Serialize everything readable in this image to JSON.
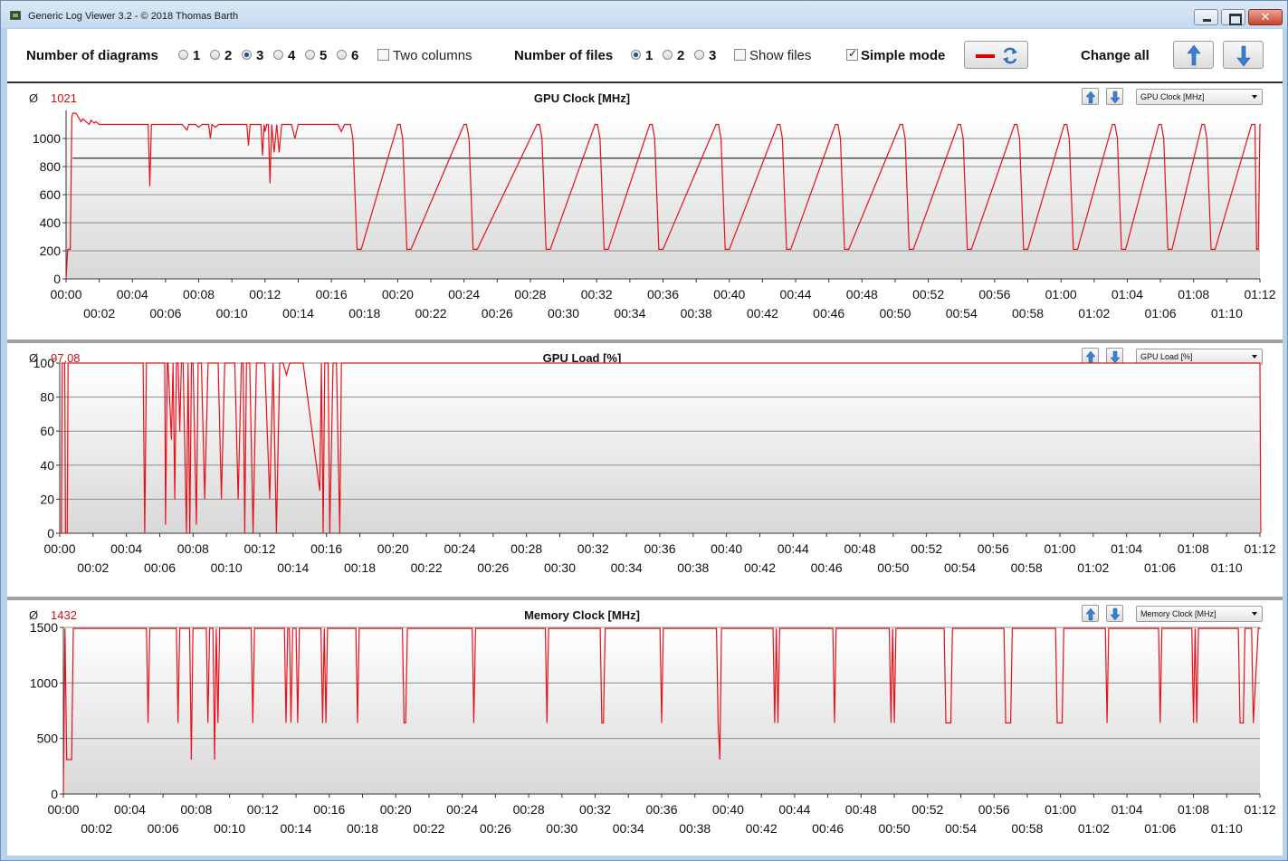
{
  "window": {
    "title": "Generic Log Viewer 3.2 - © 2018 Thomas Barth",
    "close_glyph": "✕"
  },
  "toolbar": {
    "num_diagrams_label": "Number of diagrams",
    "diagram_options": [
      "1",
      "2",
      "3",
      "4",
      "5",
      "6"
    ],
    "diagram_selected": "3",
    "two_columns_label": "Two columns",
    "two_columns_checked": false,
    "num_files_label": "Number of files",
    "file_options": [
      "1",
      "2",
      "3"
    ],
    "file_selected": "1",
    "show_files_label": "Show files",
    "show_files_checked": false,
    "simple_mode_label": "Simple mode",
    "simple_mode_checked": true,
    "change_all_label": "Change all",
    "icons": [
      "line-color-icon",
      "refresh-icon",
      "arrow-up-icon",
      "arrow-down-icon"
    ]
  },
  "colors": {
    "series": "#e8101a",
    "avg_line": "#000000",
    "grid": "#8c8c8c"
  },
  "chart_data": [
    {
      "type": "line",
      "title": "GPU Clock [MHz]",
      "avg_symbol": "Ø",
      "avg_value": "1021",
      "selector": "GPU Clock [MHz]",
      "ylim": [
        0,
        1200
      ],
      "yticks": [
        0,
        200,
        400,
        600,
        800,
        1000
      ],
      "xlim": [
        "00:00",
        "01:12"
      ],
      "xticks_row1": [
        "00:00",
        "00:04",
        "00:08",
        "00:12",
        "00:16",
        "00:20",
        "00:24",
        "00:28",
        "00:32",
        "00:36",
        "00:40",
        "00:44",
        "00:48",
        "00:52",
        "00:56",
        "01:00",
        "01:04",
        "01:08",
        "01:12"
      ],
      "xticks_row2": [
        "00:02",
        "00:06",
        "00:10",
        "00:14",
        "00:18",
        "00:22",
        "00:26",
        "00:30",
        "00:34",
        "00:38",
        "00:42",
        "00:46",
        "00:50",
        "00:54",
        "00:58",
        "01:02",
        "01:06",
        "01:10"
      ],
      "average_line": 860,
      "x_minutes": [
        0,
        0.1,
        0.25,
        0.35,
        0.4,
        0.5,
        0.6,
        0.9,
        1.0,
        1.2,
        1.3,
        1.4,
        1.5,
        1.6,
        1.7,
        1.8,
        1.9,
        2.0,
        2.2,
        2.4,
        2.6,
        2.8,
        3.0,
        3.5,
        4.0,
        4.5,
        4.95,
        5.05,
        5.15,
        5.5,
        6.0,
        6.5,
        7.0,
        7.3,
        7.4,
        7.5,
        7.8,
        8.0,
        8.2,
        8.6,
        8.7,
        8.8,
        9.0,
        9.2,
        9.5,
        10.0,
        10.5,
        10.9,
        11.0,
        11.1,
        11.5,
        11.75,
        11.85,
        11.95,
        12.0,
        12.1,
        12.2,
        12.3,
        12.4,
        12.55,
        12.7,
        12.85,
        13.0,
        13.3,
        13.6,
        13.8,
        14.0,
        14.3,
        14.8,
        15.2,
        15.6,
        16.0,
        16.2,
        16.4,
        16.6,
        16.8,
        17.0,
        17.15,
        17.3,
        17.55,
        17.8,
        20.0,
        20.15,
        20.3,
        20.55,
        20.8,
        24.0,
        24.15,
        24.3,
        24.55,
        24.8,
        28.4,
        28.55,
        28.7,
        28.95,
        29.2,
        31.9,
        32.05,
        32.2,
        32.45,
        32.7,
        35.2,
        35.35,
        35.5,
        35.75,
        36.0,
        39.2,
        39.35,
        39.5,
        39.75,
        40.0,
        42.9,
        43.05,
        43.2,
        43.45,
        43.7,
        46.4,
        46.55,
        46.7,
        46.95,
        47.2,
        50.3,
        50.45,
        50.6,
        50.85,
        51.1,
        53.8,
        53.95,
        54.1,
        54.35,
        54.6,
        57.2,
        57.35,
        57.5,
        57.75,
        58.0,
        60.2,
        60.35,
        60.5,
        60.75,
        61.0,
        63.1,
        63.25,
        63.4,
        63.65,
        63.9,
        65.9,
        66.05,
        66.2,
        66.45,
        66.7,
        68.5,
        68.65,
        68.8,
        69.05,
        69.3,
        71.5,
        71.6,
        71.7,
        71.8,
        71.9,
        72.0,
        72.05
      ],
      "values": [
        0,
        210,
        210,
        1150,
        1180,
        1180,
        1180,
        1120,
        1140,
        1120,
        1110,
        1100,
        1130,
        1120,
        1110,
        1120,
        1110,
        1100,
        1100,
        1100,
        1100,
        1100,
        1100,
        1100,
        1100,
        1100,
        1100,
        660,
        1100,
        1100,
        1100,
        1100,
        1100,
        1060,
        1100,
        1100,
        1100,
        1080,
        1100,
        1100,
        1000,
        1100,
        1080,
        1100,
        1100,
        1100,
        1100,
        1100,
        950,
        1100,
        1100,
        1100,
        880,
        1100,
        1050,
        1100,
        1100,
        680,
        1100,
        900,
        1100,
        900,
        1100,
        1100,
        1100,
        1000,
        1100,
        1100,
        1100,
        1100,
        1100,
        1100,
        1100,
        1100,
        1050,
        1100,
        1100,
        1100,
        1000,
        210,
        210,
        1100,
        1100,
        1000,
        210,
        210,
        1100,
        1100,
        1000,
        210,
        210,
        1100,
        1100,
        1000,
        210,
        210,
        1100,
        1100,
        1000,
        210,
        210,
        1100,
        1100,
        1000,
        210,
        210,
        1100,
        1100,
        1000,
        210,
        210,
        1100,
        1100,
        1000,
        210,
        210,
        1100,
        1100,
        1000,
        210,
        210,
        1100,
        1100,
        1000,
        210,
        210,
        1100,
        1100,
        1000,
        210,
        210,
        1100,
        1100,
        1000,
        210,
        210,
        1100,
        1100,
        1000,
        210,
        210,
        1100,
        1100,
        1000,
        210,
        210,
        1100,
        1100,
        1000,
        210,
        210,
        1100,
        1100,
        1000,
        210,
        210,
        1100,
        1100,
        1100,
        210,
        210,
        1100,
        1100,
        1100,
        1100,
        1000,
        300,
        0
      ]
    },
    {
      "type": "line",
      "title": "GPU Load [%]",
      "avg_symbol": "Ø",
      "avg_value": "97,08",
      "selector": "GPU Load [%]",
      "ylim": [
        0,
        100
      ],
      "yticks": [
        0,
        20,
        40,
        60,
        80,
        100
      ],
      "xlim": [
        "00:00",
        "01:12"
      ],
      "xticks_row1": [
        "00:00",
        "00:04",
        "00:08",
        "00:12",
        "00:16",
        "00:20",
        "00:24",
        "00:28",
        "00:32",
        "00:36",
        "00:40",
        "00:44",
        "00:48",
        "00:52",
        "00:56",
        "01:00",
        "01:04",
        "01:08",
        "01:12"
      ],
      "xticks_row2": [
        "00:02",
        "00:06",
        "00:10",
        "00:14",
        "00:18",
        "00:22",
        "00:26",
        "00:30",
        "00:34",
        "00:38",
        "00:42",
        "00:46",
        "00:50",
        "00:54",
        "00:58",
        "01:02",
        "01:06",
        "01:10"
      ],
      "x_minutes": [
        0,
        0.1,
        0.15,
        0.3,
        0.35,
        0.45,
        0.5,
        0.6,
        0.65,
        5.0,
        5.1,
        5.2,
        5.35,
        6.3,
        6.35,
        6.45,
        6.5,
        6.7,
        6.8,
        6.9,
        7.0,
        7.1,
        7.2,
        7.3,
        7.4,
        7.6,
        7.7,
        7.8,
        7.9,
        8.0,
        8.2,
        8.3,
        8.5,
        8.7,
        8.9,
        9.1,
        9.3,
        9.5,
        9.7,
        9.9,
        10.1,
        10.3,
        10.5,
        10.7,
        10.9,
        11.0,
        11.1,
        11.2,
        11.4,
        11.6,
        11.8,
        12.0,
        12.1,
        12.3,
        12.6,
        12.8,
        13.0,
        13.2,
        13.4,
        13.6,
        13.8,
        14.0,
        14.15,
        14.3,
        14.45,
        14.6,
        15.6,
        15.7,
        15.8,
        15.9,
        16.0,
        16.1,
        16.2,
        16.4,
        16.6,
        16.8,
        16.9,
        17.0,
        72.0,
        72.05
      ],
      "values": [
        0,
        0,
        100,
        100,
        0,
        0,
        100,
        100,
        100,
        100,
        0,
        100,
        100,
        100,
        5,
        100,
        100,
        55,
        100,
        20,
        100,
        100,
        60,
        100,
        100,
        0,
        100,
        0,
        100,
        100,
        5,
        100,
        100,
        20,
        100,
        100,
        100,
        100,
        20,
        100,
        100,
        100,
        100,
        20,
        100,
        100,
        0,
        100,
        100,
        0,
        100,
        100,
        100,
        100,
        20,
        100,
        0,
        100,
        100,
        93,
        100,
        100,
        100,
        100,
        100,
        100,
        25,
        100,
        0,
        100,
        100,
        100,
        0,
        100,
        100,
        0,
        100,
        100,
        100,
        0
      ]
    },
    {
      "type": "line",
      "title": "Memory Clock [MHz]",
      "avg_symbol": "Ø",
      "avg_value": "1432",
      "selector": "Memory Clock [MHz]",
      "ylim": [
        0,
        1500
      ],
      "yticks": [
        0,
        500,
        1000,
        1500
      ],
      "xlim": [
        "00:00",
        "01:12"
      ],
      "xticks_row1": [
        "00:00",
        "00:04",
        "00:08",
        "00:12",
        "00:16",
        "00:20",
        "00:24",
        "00:28",
        "00:32",
        "00:36",
        "00:40",
        "00:44",
        "00:48",
        "00:52",
        "00:56",
        "01:00",
        "01:04",
        "01:08",
        "01:12"
      ],
      "xticks_row2": [
        "00:02",
        "00:06",
        "00:10",
        "00:14",
        "00:18",
        "00:22",
        "00:26",
        "00:30",
        "00:34",
        "00:38",
        "00:42",
        "00:46",
        "00:50",
        "00:54",
        "00:58",
        "01:02",
        "01:06",
        "01:10"
      ],
      "x_minutes": [
        0,
        0.1,
        0.2,
        0.4,
        0.5,
        0.6,
        0.7,
        0.9,
        5.0,
        5.1,
        5.2,
        6.8,
        6.9,
        7.0,
        7.6,
        7.7,
        7.8,
        8.6,
        8.7,
        8.8,
        8.9,
        9.0,
        9.1,
        9.2,
        9.3,
        9.4,
        11.3,
        11.4,
        11.5,
        13.3,
        13.4,
        13.5,
        13.6,
        13.7,
        13.8,
        14.0,
        14.1,
        14.2,
        15.5,
        15.6,
        15.7,
        15.8,
        15.9,
        17.6,
        17.7,
        17.8,
        20.4,
        20.5,
        20.6,
        20.7,
        24.6,
        24.7,
        24.8,
        29.0,
        29.1,
        29.2,
        32.3,
        32.4,
        32.5,
        32.6,
        32.7,
        35.9,
        36.0,
        36.1,
        39.3,
        39.4,
        39.5,
        39.6,
        42.7,
        42.8,
        42.9,
        43.0,
        43.1,
        46.3,
        46.4,
        46.5,
        49.7,
        49.8,
        49.9,
        50.0,
        50.1,
        53.0,
        53.1,
        53.4,
        53.5,
        56.6,
        56.7,
        57.0,
        57.1,
        59.7,
        59.8,
        60.1,
        60.2,
        62.7,
        62.8,
        62.9,
        65.9,
        66.0,
        66.1,
        67.9,
        68.0,
        68.1,
        68.2,
        68.3,
        68.4,
        70.7,
        70.8,
        71.0,
        71.1,
        71.4,
        71.5,
        71.6,
        71.9,
        72.05
      ],
      "values": [
        0,
        1490,
        310,
        310,
        310,
        1490,
        1490,
        1490,
        1490,
        640,
        1490,
        1490,
        640,
        1490,
        1490,
        310,
        1490,
        1490,
        640,
        1490,
        1490,
        1490,
        310,
        1490,
        640,
        1490,
        1490,
        640,
        1490,
        1490,
        640,
        1490,
        1490,
        640,
        1490,
        1490,
        640,
        1490,
        1490,
        640,
        1490,
        640,
        1490,
        1490,
        640,
        1490,
        1490,
        640,
        640,
        1490,
        1490,
        640,
        1490,
        1490,
        640,
        1490,
        1490,
        640,
        640,
        1490,
        1490,
        1490,
        640,
        1490,
        1490,
        640,
        310,
        1490,
        1490,
        640,
        1490,
        640,
        1490,
        1490,
        640,
        1490,
        1490,
        640,
        1490,
        640,
        1490,
        1490,
        640,
        640,
        1490,
        1490,
        640,
        640,
        1490,
        1490,
        640,
        640,
        1490,
        1490,
        640,
        1490,
        1490,
        640,
        1490,
        1490,
        640,
        1490,
        640,
        1490,
        1490,
        1490,
        640,
        640,
        1490,
        1490,
        1490,
        640,
        1490,
        1490,
        0
      ]
    }
  ]
}
